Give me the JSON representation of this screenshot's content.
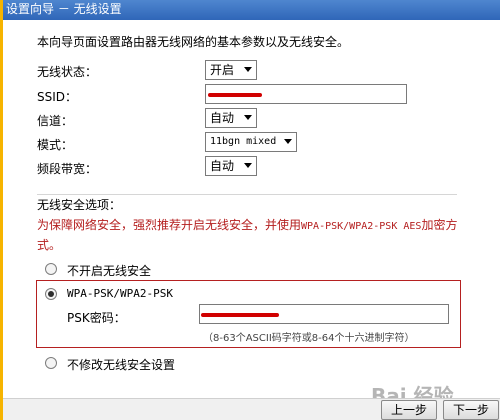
{
  "window": {
    "title": "设置向导 － 无线设置"
  },
  "intro": "本向导页面设置路由器无线网络的基本参数以及无线安全。",
  "basic": {
    "wireless_status": {
      "label": "无线状态：",
      "value": "开启"
    },
    "ssid": {
      "label": "SSID：",
      "value": ""
    },
    "channel": {
      "label": "信道：",
      "value": "自动"
    },
    "mode": {
      "label": "模式：",
      "value": "11bgn mixed"
    },
    "bandwidth": {
      "label": "频段带宽：",
      "value": "自动"
    }
  },
  "security": {
    "heading": "无线安全选项：",
    "warning_part1": "为保障网络安全，强烈推荐开启无线安全，并使用",
    "warning_mono": "WPA-PSK/WPA2-PSK AES",
    "warning_part2": "加密方",
    "warning_line2": "式。",
    "option_none": "不开启无线安全",
    "option_wpa": "WPA-PSK/WPA2-PSK",
    "psk_label": "PSK密码：",
    "psk_value": "",
    "psk_hint": "（8-63个ASCII码字符或8-64个十六进制字符）",
    "option_keep": "不修改无线安全设置",
    "selected": "wpa"
  },
  "buttons": {
    "prev": "上一步",
    "next": "下一步"
  },
  "watermark": "Bai 经验",
  "colors": {
    "title_bar": "#3a72c4",
    "warning": "#b41e1e",
    "redaction": "#d10000",
    "accent": "#f6b400"
  }
}
